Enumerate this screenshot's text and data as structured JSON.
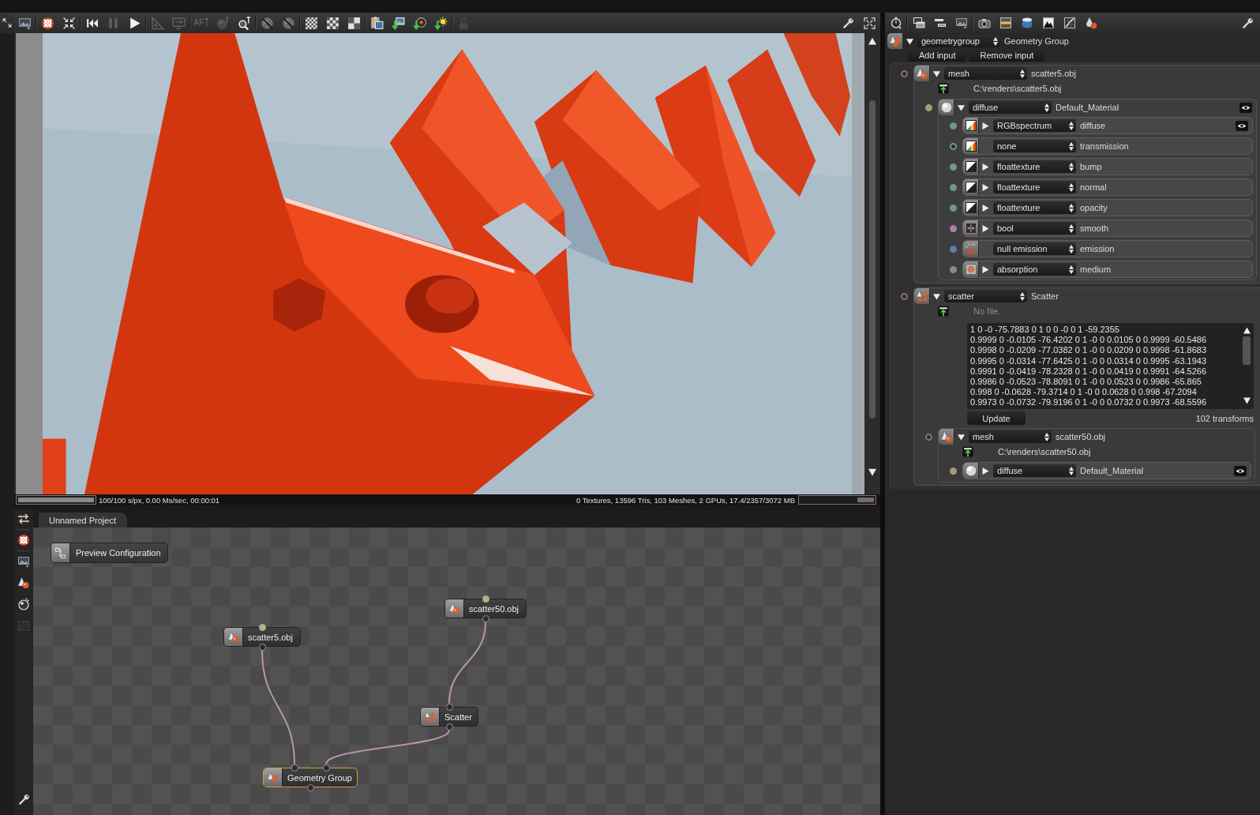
{
  "viewport_toolbar": {
    "groups": [
      [
        {
          "kind": "picture",
          "disabled": false
        }
      ],
      [
        {
          "kind": "target",
          "disabled": false
        },
        {
          "kind": "fit",
          "disabled": false
        }
      ],
      [
        {
          "kind": "rewind",
          "disabled": false
        },
        {
          "kind": "pause",
          "disabled": true
        },
        {
          "kind": "play",
          "disabled": false
        }
      ],
      [
        {
          "kind": "ruler",
          "disabled": true
        },
        {
          "kind": "monitor",
          "disabled": true
        }
      ],
      [
        {
          "kind": "autofocus",
          "label": "AF",
          "disabled": true
        },
        {
          "kind": "spherepin",
          "disabled": true
        },
        {
          "kind": "picker",
          "disabled": false
        }
      ],
      [
        {
          "kind": "sphereoff",
          "disabled": false
        },
        {
          "kind": "sphereoff",
          "disabled": false
        }
      ],
      [
        {
          "kind": "checkerfine",
          "disabled": false
        },
        {
          "kind": "checkermedium",
          "disabled": false
        },
        {
          "kind": "checkercoarse",
          "disabled": false
        }
      ],
      [
        {
          "kind": "copy",
          "disabled": false
        },
        {
          "kind": "importimage",
          "disabled": false
        },
        {
          "kind": "importdisc",
          "disabled": false
        },
        {
          "kind": "importsun",
          "disabled": false
        }
      ],
      [
        {
          "kind": "lock",
          "disabled": true
        }
      ]
    ]
  },
  "status_bar": {
    "progress": {
      "level": 1
    },
    "render_stats": "100/100 s/px, 0.00 Ms/sec, 00:00:01",
    "scene_stats": "0 Textures, 13596 Tris, 103 Meshes, 2 GPUs, 17.4/2357/3072 MB",
    "memory": {
      "level": 0.23
    }
  },
  "node_graph": {
    "tab": {
      "label": "Unnamed Project",
      "selected": true
    },
    "preview_button": "Preview Configuration",
    "root": {
      "kind": "group",
      "label": "Geometry Group",
      "selected": true,
      "inputs": [
        {
          "kind": "mesh",
          "label": "scatter5.obj",
          "selected": false
        },
        {
          "kind": "scatter",
          "label": "Scatter",
          "selected": false,
          "inputs": [
            {
              "kind": "mesh",
              "label": "scatter50.obj",
              "selected": false
            }
          ]
        }
      ]
    }
  },
  "inspector": {
    "root": {
      "kind": "group",
      "type": "geometrygroup",
      "name": "Geometry Group",
      "expanded": true,
      "buttons": [
        "Add input",
        "Remove input"
      ],
      "inputs": [
        {
          "kind": "mesh",
          "type": "mesh",
          "name": "scatter5.obj",
          "expanded": true,
          "color": "#8e6b88",
          "port_filled": false,
          "file": "C:\\renders\\scatter5.obj",
          "inputs": [
            {
              "kind": "material",
              "type": "diffuse",
              "name": "Default_Material",
              "expanded": true,
              "eye_button": true,
              "color": "#a89c74",
              "port_filled": true,
              "inputs": [
                {
                  "kind": "spectrum",
                  "type": "RGBspectrum",
                  "name": "diffuse",
                  "expanded": false,
                  "eye_button": true,
                  "color": "#6f9a7f",
                  "port_filled": true
                },
                {
                  "kind": "spectrum",
                  "type": "none",
                  "name": "transmission",
                  "color": "#6f9a7f",
                  "port_filled": false
                },
                {
                  "kind": "float",
                  "type": "floattexture",
                  "name": "bump",
                  "expanded": false,
                  "color": "#6f9a7f",
                  "port_filled": true
                },
                {
                  "kind": "float",
                  "type": "floattexture",
                  "name": "normal",
                  "expanded": false,
                  "color": "#6f9a7f",
                  "port_filled": true
                },
                {
                  "kind": "float",
                  "type": "floattexture",
                  "name": "opacity",
                  "expanded": false,
                  "color": "#6f9a7f",
                  "port_filled": true
                },
                {
                  "kind": "bool",
                  "type": "bool",
                  "name": "smooth",
                  "expanded": false,
                  "color": "#b07ea8",
                  "port_filled": true
                },
                {
                  "kind": "emission",
                  "type": "null emission",
                  "name": "emission",
                  "color": "#5b7eb0",
                  "port_filled": true
                },
                {
                  "kind": "medium",
                  "type": "absorption",
                  "name": "medium",
                  "expanded": false,
                  "color": "#8c8c8c",
                  "port_filled": true
                }
              ]
            }
          ]
        },
        {
          "kind": "scatter",
          "type": "scatter",
          "name": "Scatter",
          "expanded": true,
          "color": "#8e6b88",
          "port_filled": false,
          "file_note": "No file.",
          "transforms": [
            "1 0 -0 -75.7883 0 1 0 0 -0 0 1 -59.2355",
            "0.9999 0 -0.0105 -76.4202 0 1 -0 0 0.0105 0 0.9999 -60.5486",
            "0.9998 0 -0.0209 -77.0382 0 1 -0 0 0.0209 0 0.9998 -61.8683",
            "0.9995 0 -0.0314 -77.6425 0 1 -0 0 0.0314 0 0.9995 -63.1943",
            "0.9991 0 -0.0419 -78.2328 0 1 -0 0 0.0419 0 0.9991 -64.5266",
            "0.9986 0 -0.0523 -78.8091 0 1 -0 0 0.0523 0 0.9986 -65.865",
            "0.998 0 -0.0628 -79.3714 0 1 -0 0 0.0628 0 0.998 -67.2094",
            "0.9973 0 -0.0732 -79.9196 0 1 -0 0 0.0732 0 0.9973 -68.5596"
          ],
          "update_button": "Update",
          "count": "102 transforms",
          "inputs": [
            {
              "kind": "mesh",
              "type": "mesh",
              "name": "scatter50.obj",
              "expanded": true,
              "color": "#8e6b88",
              "port_filled": false,
              "file": "C:\\renders\\scatter50.obj",
              "inputs": [
                {
                  "kind": "material",
                  "type": "diffuse",
                  "name": "Default_Material",
                  "expanded": false,
                  "eye_button": true,
                  "color": "#a89c74",
                  "port_filled": true
                }
              ]
            }
          ]
        }
      ]
    }
  }
}
